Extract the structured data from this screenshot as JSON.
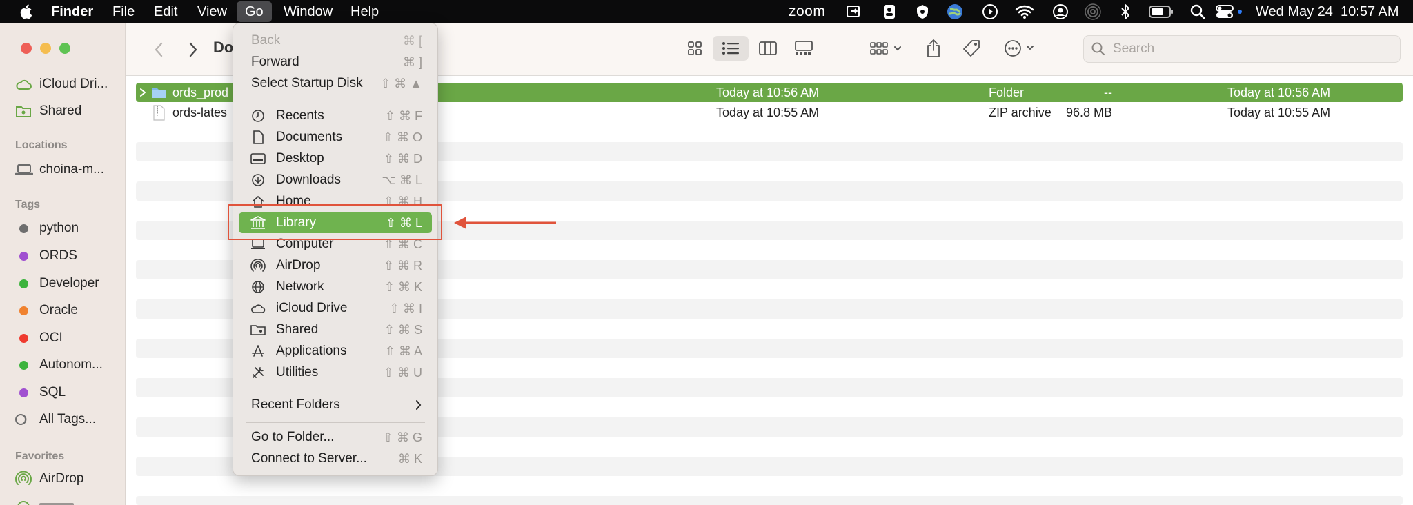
{
  "menubar": {
    "app_name": "Finder",
    "menus": [
      "File",
      "Edit",
      "View",
      "Go",
      "Window",
      "Help"
    ],
    "zoom_label": "zoom",
    "clock": "Wed May 24  10:57 AM"
  },
  "toolbar": {
    "title": "Do",
    "search_placeholder": "Search"
  },
  "sidebar": {
    "top_items": [
      {
        "label": "iCloud Dri...",
        "icon": "cloud-icon"
      },
      {
        "label": "Shared",
        "icon": "shared-folder-icon"
      }
    ],
    "locations_heading": "Locations",
    "locations": [
      {
        "label": "choina-m...",
        "icon": "laptop-icon"
      }
    ],
    "tags_heading": "Tags",
    "tags": [
      {
        "label": "python",
        "color": "#6e6e6e"
      },
      {
        "label": "ORDS",
        "color": "#a050d0"
      },
      {
        "label": "Developer",
        "color": "#3db33d"
      },
      {
        "label": "Oracle",
        "color": "#f0822f"
      },
      {
        "label": "OCI",
        "color": "#ef3b2f"
      },
      {
        "label": "Autonom...",
        "color": "#3db33d"
      },
      {
        "label": "SQL",
        "color": "#a050d0"
      }
    ],
    "all_tags": "All Tags...",
    "favorites_heading": "Favorites",
    "favorites": [
      {
        "label": "AirDrop",
        "icon": "airdrop-icon"
      }
    ]
  },
  "files": [
    {
      "name": "ords_prod",
      "date_modified": "Today at 10:56 AM",
      "size": "--",
      "kind": "Folder",
      "date_added": "Today at 10:56 AM",
      "selected": true
    },
    {
      "name": "ords-lates",
      "date_modified": "Today at 10:55 AM",
      "size": "96.8 MB",
      "kind": "ZIP archive",
      "date_added": "Today at 10:55 AM",
      "selected": false
    }
  ],
  "go_menu": {
    "back": {
      "label": "Back",
      "shortcut": "⌘ ["
    },
    "forward": {
      "label": "Forward",
      "shortcut": "⌘ ]"
    },
    "startup": {
      "label": "Select Startup Disk",
      "shortcut": "⇧ ⌘ ▲"
    },
    "recents": {
      "label": "Recents",
      "shortcut": "⇧ ⌘ F"
    },
    "documents": {
      "label": "Documents",
      "shortcut": "⇧ ⌘ O"
    },
    "desktop": {
      "label": "Desktop",
      "shortcut": "⇧ ⌘ D"
    },
    "downloads": {
      "label": "Downloads",
      "shortcut": "⌥ ⌘ L"
    },
    "home": {
      "label": "Home",
      "shortcut": "⇧ ⌘ H"
    },
    "library": {
      "label": "Library",
      "shortcut": "⇧ ⌘ L"
    },
    "computer": {
      "label": "Computer",
      "shortcut": "⇧ ⌘ C"
    },
    "airdrop": {
      "label": "AirDrop",
      "shortcut": "⇧ ⌘ R"
    },
    "network": {
      "label": "Network",
      "shortcut": "⇧ ⌘ K"
    },
    "icloud": {
      "label": "iCloud Drive",
      "shortcut": "⇧ ⌘ I"
    },
    "shared": {
      "label": "Shared",
      "shortcut": "⇧ ⌘ S"
    },
    "applications": {
      "label": "Applications",
      "shortcut": "⇧ ⌘ A"
    },
    "utilities": {
      "label": "Utilities",
      "shortcut": "⇧ ⌘ U"
    },
    "recent_folders": {
      "label": "Recent Folders"
    },
    "go_to_folder": {
      "label": "Go to Folder...",
      "shortcut": "⇧ ⌘ G"
    },
    "connect_server": {
      "label": "Connect to Server...",
      "shortcut": "⌘ K"
    }
  },
  "colors": {
    "selection_green": "#6aa746",
    "menu_highlight": "#6fb34f",
    "callout_red": "#e0533b"
  }
}
